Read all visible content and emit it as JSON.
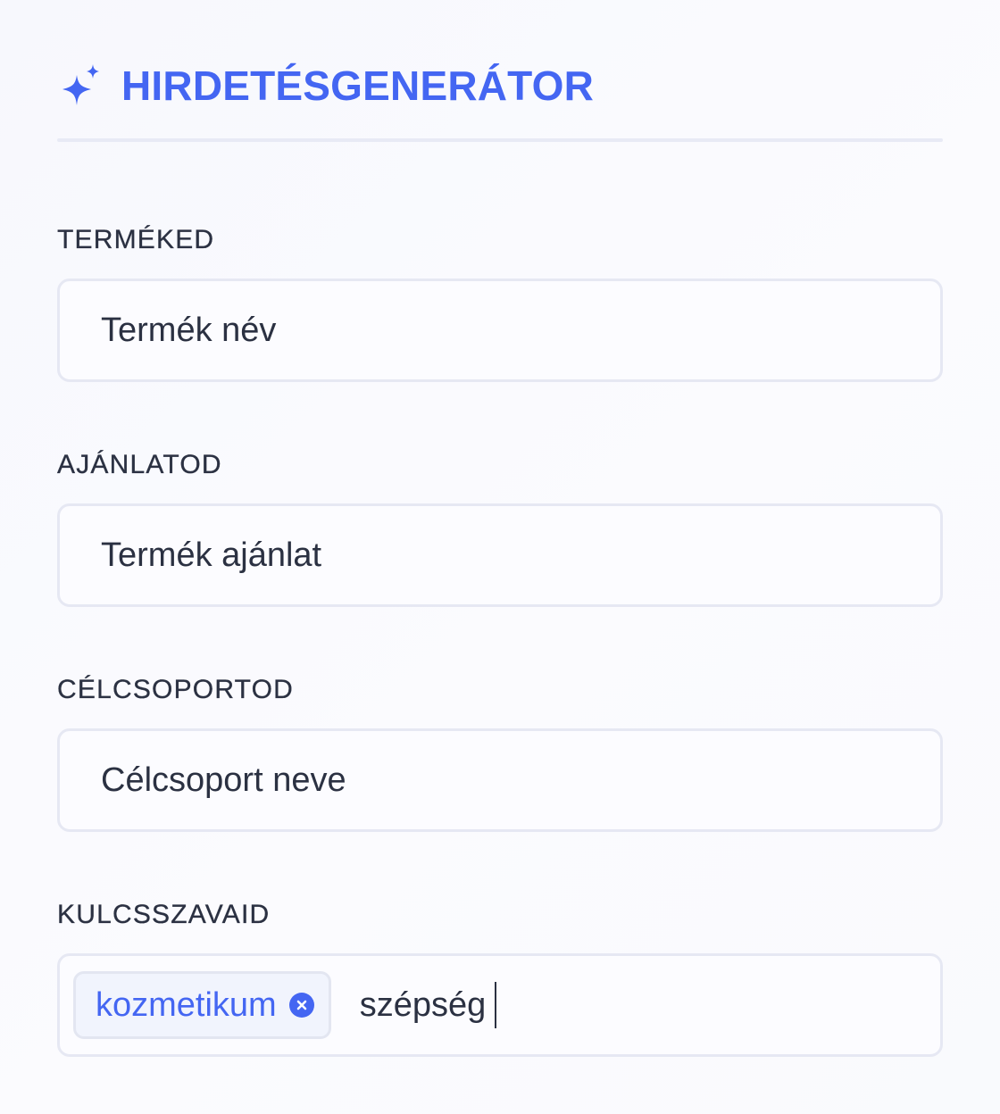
{
  "header": {
    "title": "HIRDETÉSGENERÁTOR",
    "icon": "sparkle-icon",
    "accent_color": "#4466f2"
  },
  "fields": {
    "product": {
      "label": "TERMÉKED",
      "placeholder": "Termék név",
      "value": ""
    },
    "offer": {
      "label": "AJÁNLATOD",
      "placeholder": "Termék ajánlat",
      "value": ""
    },
    "audience": {
      "label": "CÉLCSOPORTOD",
      "placeholder": "Célcsoport neve",
      "value": ""
    },
    "keywords": {
      "label": "KULCSSZAVAID",
      "tags": [
        "kozmetikum"
      ],
      "input_value": "szépség"
    }
  }
}
